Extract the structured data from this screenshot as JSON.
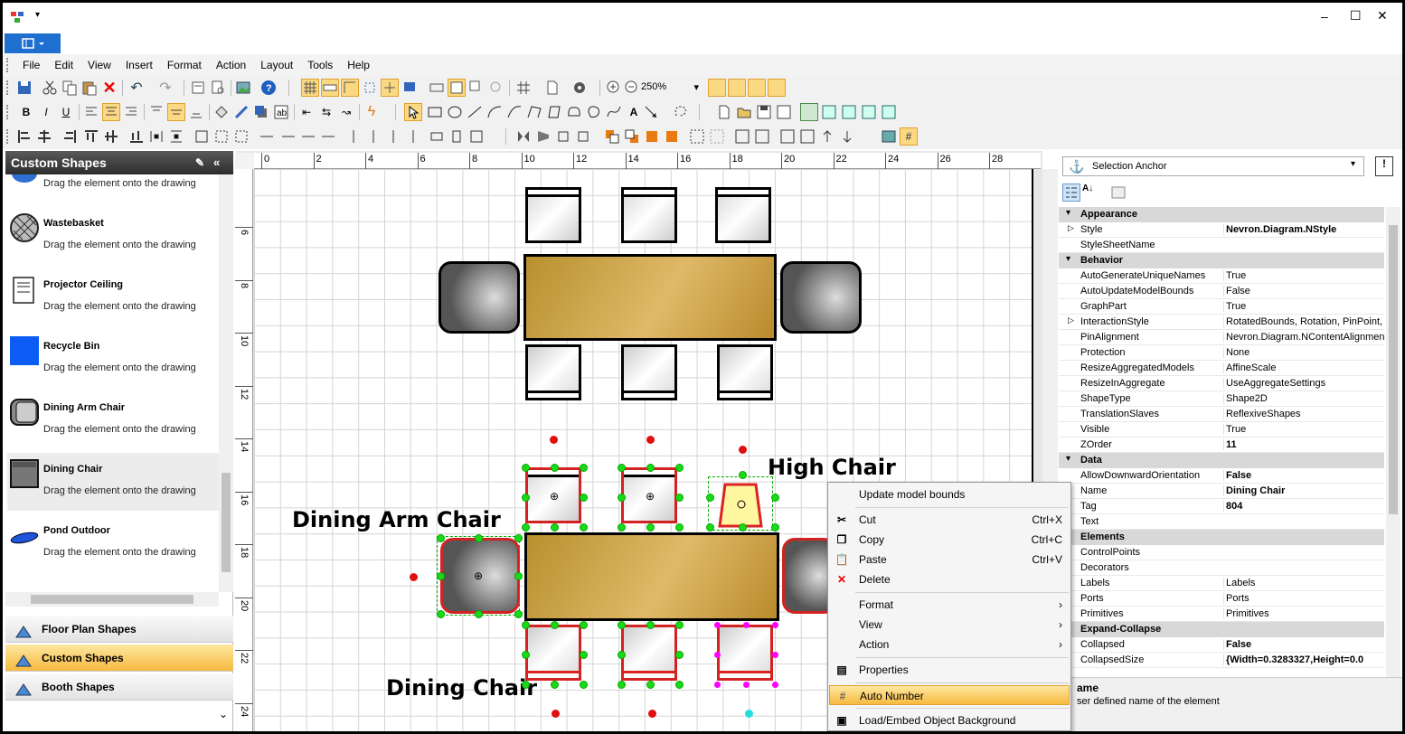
{
  "app": {
    "qat_arrow": "▾",
    "window_controls": {
      "min": "–",
      "max": "☐",
      "close": "✕"
    }
  },
  "menu": [
    "File",
    "Edit",
    "View",
    "Insert",
    "Format",
    "Action",
    "Layout",
    "Tools",
    "Help"
  ],
  "toolbar": {
    "zoom": "250%"
  },
  "left_panel": {
    "title": "Custom Shapes",
    "items": [
      {
        "name": "Wastebasket",
        "desc": "Drag the element onto the drawing"
      },
      {
        "name": "Projector Ceiling",
        "desc": "Drag the element onto the drawing"
      },
      {
        "name": "Recycle Bin",
        "desc": "Drag the element onto the drawing"
      },
      {
        "name": "Dining Arm Chair",
        "desc": "Drag the element onto the drawing"
      },
      {
        "name": "Dining Chair",
        "desc": "Drag the element onto the drawing"
      },
      {
        "name": "Pond Outdoor",
        "desc": "Drag the element onto the drawing"
      }
    ],
    "first_desc": "Drag the element onto the drawing",
    "categories": [
      "Floor Plan Shapes",
      "Custom Shapes",
      "Booth Shapes"
    ]
  },
  "ruler": {
    "h": [
      "0",
      "2",
      "4",
      "6",
      "8",
      "10",
      "12",
      "14",
      "16",
      "18",
      "20",
      "22",
      "24",
      "26",
      "28"
    ],
    "v": [
      "6",
      "8",
      "10",
      "12",
      "14",
      "16",
      "18",
      "20",
      "22",
      "24"
    ]
  },
  "drawing": {
    "labels": {
      "high_chair": "High Chair",
      "dining_arm_chair": "Dining Arm Chair",
      "dining_chair": "Dining Chair"
    }
  },
  "properties": {
    "selector": "Selection Anchor",
    "categories": {
      "appearance": "Appearance",
      "behavior": "Behavior",
      "data": "Data",
      "elements": "Elements",
      "expand": "Expand-Collapse"
    },
    "appearance": [
      [
        "Style",
        "Nevron.Diagram.NStyle"
      ],
      [
        "StyleSheetName",
        ""
      ]
    ],
    "behavior": [
      [
        "AutoGenerateUniqueNames",
        "True"
      ],
      [
        "AutoUpdateModelBounds",
        "False"
      ],
      [
        "GraphPart",
        "True"
      ],
      [
        "InteractionStyle",
        "RotatedBounds, Rotation, PinPoint, S"
      ],
      [
        "PinAlignment",
        "Nevron.Diagram.NContentAlignment"
      ],
      [
        "Protection",
        "None"
      ],
      [
        "ResizeAggregatedModels",
        "AffineScale"
      ],
      [
        "ResizeInAggregate",
        "UseAggregateSettings"
      ],
      [
        "ShapeType",
        "Shape2D"
      ],
      [
        "TranslationSlaves",
        "ReflexiveShapes"
      ],
      [
        "Visible",
        "True"
      ],
      [
        "ZOrder",
        "11"
      ]
    ],
    "data": [
      [
        "AllowDownwardOrientation",
        "False"
      ],
      [
        "Name",
        "Dining Chair"
      ],
      [
        "Tag",
        "804"
      ],
      [
        "Text",
        ""
      ]
    ],
    "elements": [
      [
        "ControlPoints",
        ""
      ],
      [
        "Decorators",
        ""
      ],
      [
        "Labels",
        "Labels"
      ],
      [
        "Ports",
        "Ports"
      ],
      [
        "Primitives",
        "Primitives"
      ]
    ],
    "expand": [
      [
        "Collapsed",
        "False"
      ],
      [
        "CollapsedSize",
        "{Width=0.3283327,Height=0.0"
      ]
    ],
    "help_title": "ame",
    "help_text": "ser defined name of the element"
  },
  "context_menu": {
    "items": [
      {
        "label": "Update model bounds",
        "shortcut": ""
      },
      {
        "label": "Cut",
        "shortcut": "Ctrl+X"
      },
      {
        "label": "Copy",
        "shortcut": "Ctrl+C"
      },
      {
        "label": "Paste",
        "shortcut": "Ctrl+V"
      },
      {
        "label": "Delete",
        "shortcut": ""
      },
      {
        "label": "Format",
        "shortcut": "›"
      },
      {
        "label": "View",
        "shortcut": "›"
      },
      {
        "label": "Action",
        "shortcut": "›"
      },
      {
        "label": "Properties",
        "shortcut": ""
      },
      {
        "label": "Auto Number",
        "shortcut": ""
      },
      {
        "label": "Load/Embed Object Background",
        "shortcut": ""
      }
    ]
  }
}
